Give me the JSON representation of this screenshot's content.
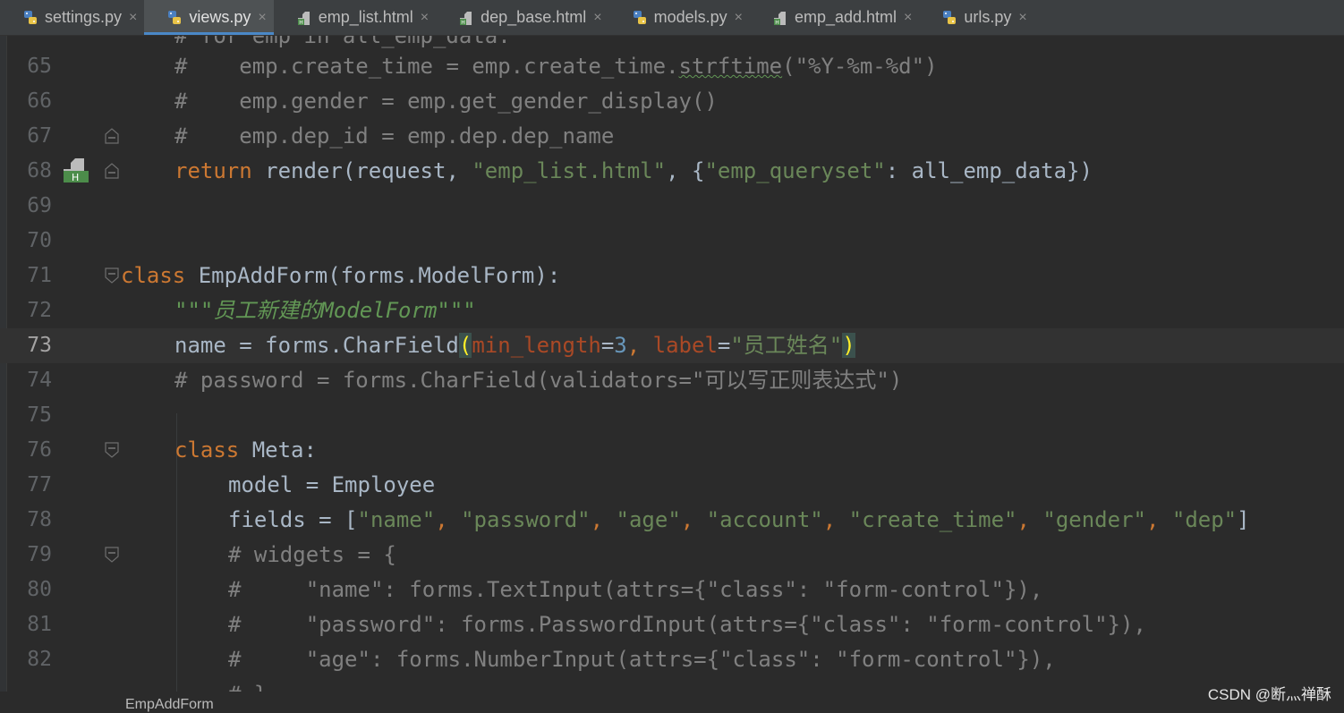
{
  "tabs": [
    {
      "label": "settings.py",
      "type": "python",
      "active": false
    },
    {
      "label": "views.py",
      "type": "python",
      "active": true
    },
    {
      "label": "emp_list.html",
      "type": "html",
      "active": false
    },
    {
      "label": "dep_base.html",
      "type": "html",
      "active": false
    },
    {
      "label": "models.py",
      "type": "python",
      "active": false
    },
    {
      "label": "emp_add.html",
      "type": "html",
      "active": false
    },
    {
      "label": "urls.py",
      "type": "python",
      "active": false
    }
  ],
  "close_glyph": "×",
  "line_numbers": [
    "65",
    "66",
    "67",
    "68",
    "69",
    "70",
    "71",
    "72",
    "73",
    "74",
    "75",
    "76",
    "77",
    "78",
    "79",
    "80",
    "81",
    "82"
  ],
  "code": {
    "l64": "# for emp in all_emp_data:",
    "l65": [
      "#",
      "    emp.create_time = emp.create_time.",
      "strftime",
      "(\"%Y-%m-%d\")"
    ],
    "l66": [
      "#",
      "    emp.gender = emp.get_gender_display()"
    ],
    "l67": [
      "#",
      "    emp.dep_id = emp.dep.dep_name"
    ],
    "l68": [
      "return",
      " render(request, ",
      "\"emp_list.html\"",
      ", {",
      "\"emp_queryset\"",
      ": all_emp_data})"
    ],
    "l71": [
      "class",
      " EmpAddForm(forms.ModelForm):"
    ],
    "l72": "\"\"\"员工新建的ModelForm\"\"\"",
    "l73": [
      "name = forms.CharField",
      "(",
      "min_length",
      "=",
      "3",
      ", ",
      "label",
      "=",
      "\"员工姓名\"",
      ")"
    ],
    "l74": "# password = forms.CharField(validators=\"可以写正则表达式\")",
    "l76": [
      "class",
      " Meta:"
    ],
    "l77": "model = Employee",
    "l78": [
      "fields = [",
      "\"name\"",
      ", ",
      "\"password\"",
      ", ",
      "\"age\"",
      ", ",
      "\"account\"",
      ", ",
      "\"create_time\"",
      ", ",
      "\"gender\"",
      ", ",
      "\"dep\"",
      "]"
    ],
    "l79": "# widgets = {",
    "l80": "#     \"name\": forms.TextInput(attrs={\"class\": \"form-control\"}),",
    "l81": "#     \"password\": forms.PasswordInput(attrs={\"class\": \"form-control\"}),",
    "l82": "#     \"age\": forms.NumberInput(attrs={\"class\": \"form-control\"}),",
    "l83": "# }"
  },
  "breadcrumb": "EmpAddForm",
  "watermark": "CSDN @断灬禅酥"
}
